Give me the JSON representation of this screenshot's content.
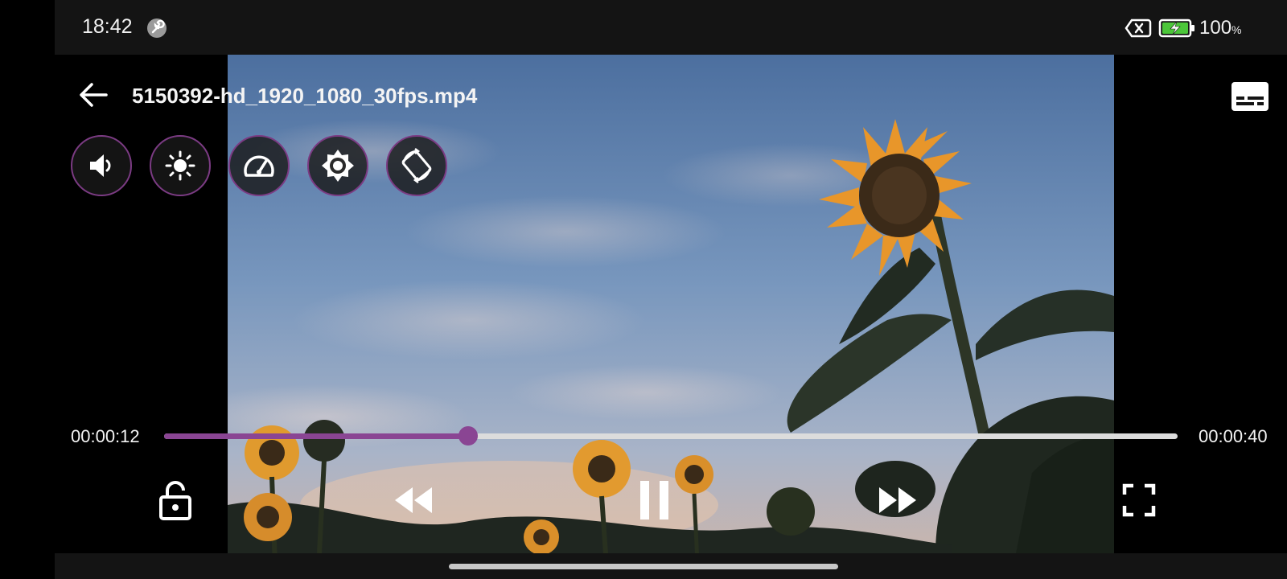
{
  "status_bar": {
    "time": "18:42",
    "battery_percent": "100",
    "battery_unit": "%",
    "icons": [
      "wrench-icon",
      "sim-card-x-icon",
      "battery-charging-icon"
    ]
  },
  "player": {
    "title": "5150392-hd_1920_1080_30fps.mp4",
    "current_time": "00:00:12",
    "total_time": "00:00:40",
    "progress_fraction": 0.3,
    "state": "playing",
    "accent_color": "#8a4593"
  },
  "quick_controls": [
    {
      "name": "volume",
      "icon": "volume-icon"
    },
    {
      "name": "brightness",
      "icon": "brightness-icon"
    },
    {
      "name": "playback-speed",
      "icon": "speedometer-icon"
    },
    {
      "name": "auto-brightness",
      "icon": "brightness-auto-icon"
    },
    {
      "name": "rotate",
      "icon": "screen-rotation-icon"
    }
  ],
  "bottom_controls": [
    {
      "name": "lock",
      "icon": "lock-icon"
    },
    {
      "name": "rewind",
      "icon": "rewind-icon"
    },
    {
      "name": "pause",
      "icon": "pause-icon"
    },
    {
      "name": "fast-forward",
      "icon": "fast-forward-icon"
    },
    {
      "name": "fullscreen",
      "icon": "fullscreen-icon"
    }
  ]
}
